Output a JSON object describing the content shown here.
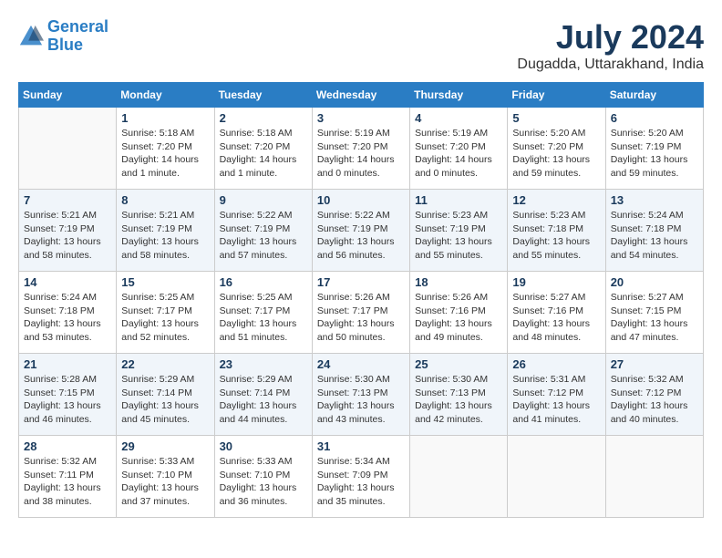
{
  "logo": {
    "line1": "General",
    "line2": "Blue"
  },
  "title": "July 2024",
  "location": "Dugadda, Uttarakhand, India",
  "days_of_week": [
    "Sunday",
    "Monday",
    "Tuesday",
    "Wednesday",
    "Thursday",
    "Friday",
    "Saturday"
  ],
  "weeks": [
    [
      {
        "num": "",
        "info": ""
      },
      {
        "num": "1",
        "info": "Sunrise: 5:18 AM\nSunset: 7:20 PM\nDaylight: 14 hours\nand 1 minute."
      },
      {
        "num": "2",
        "info": "Sunrise: 5:18 AM\nSunset: 7:20 PM\nDaylight: 14 hours\nand 1 minute."
      },
      {
        "num": "3",
        "info": "Sunrise: 5:19 AM\nSunset: 7:20 PM\nDaylight: 14 hours\nand 0 minutes."
      },
      {
        "num": "4",
        "info": "Sunrise: 5:19 AM\nSunset: 7:20 PM\nDaylight: 14 hours\nand 0 minutes."
      },
      {
        "num": "5",
        "info": "Sunrise: 5:20 AM\nSunset: 7:20 PM\nDaylight: 13 hours\nand 59 minutes."
      },
      {
        "num": "6",
        "info": "Sunrise: 5:20 AM\nSunset: 7:19 PM\nDaylight: 13 hours\nand 59 minutes."
      }
    ],
    [
      {
        "num": "7",
        "info": "Sunrise: 5:21 AM\nSunset: 7:19 PM\nDaylight: 13 hours\nand 58 minutes."
      },
      {
        "num": "8",
        "info": "Sunrise: 5:21 AM\nSunset: 7:19 PM\nDaylight: 13 hours\nand 58 minutes."
      },
      {
        "num": "9",
        "info": "Sunrise: 5:22 AM\nSunset: 7:19 PM\nDaylight: 13 hours\nand 57 minutes."
      },
      {
        "num": "10",
        "info": "Sunrise: 5:22 AM\nSunset: 7:19 PM\nDaylight: 13 hours\nand 56 minutes."
      },
      {
        "num": "11",
        "info": "Sunrise: 5:23 AM\nSunset: 7:19 PM\nDaylight: 13 hours\nand 55 minutes."
      },
      {
        "num": "12",
        "info": "Sunrise: 5:23 AM\nSunset: 7:18 PM\nDaylight: 13 hours\nand 55 minutes."
      },
      {
        "num": "13",
        "info": "Sunrise: 5:24 AM\nSunset: 7:18 PM\nDaylight: 13 hours\nand 54 minutes."
      }
    ],
    [
      {
        "num": "14",
        "info": "Sunrise: 5:24 AM\nSunset: 7:18 PM\nDaylight: 13 hours\nand 53 minutes."
      },
      {
        "num": "15",
        "info": "Sunrise: 5:25 AM\nSunset: 7:17 PM\nDaylight: 13 hours\nand 52 minutes."
      },
      {
        "num": "16",
        "info": "Sunrise: 5:25 AM\nSunset: 7:17 PM\nDaylight: 13 hours\nand 51 minutes."
      },
      {
        "num": "17",
        "info": "Sunrise: 5:26 AM\nSunset: 7:17 PM\nDaylight: 13 hours\nand 50 minutes."
      },
      {
        "num": "18",
        "info": "Sunrise: 5:26 AM\nSunset: 7:16 PM\nDaylight: 13 hours\nand 49 minutes."
      },
      {
        "num": "19",
        "info": "Sunrise: 5:27 AM\nSunset: 7:16 PM\nDaylight: 13 hours\nand 48 minutes."
      },
      {
        "num": "20",
        "info": "Sunrise: 5:27 AM\nSunset: 7:15 PM\nDaylight: 13 hours\nand 47 minutes."
      }
    ],
    [
      {
        "num": "21",
        "info": "Sunrise: 5:28 AM\nSunset: 7:15 PM\nDaylight: 13 hours\nand 46 minutes."
      },
      {
        "num": "22",
        "info": "Sunrise: 5:29 AM\nSunset: 7:14 PM\nDaylight: 13 hours\nand 45 minutes."
      },
      {
        "num": "23",
        "info": "Sunrise: 5:29 AM\nSunset: 7:14 PM\nDaylight: 13 hours\nand 44 minutes."
      },
      {
        "num": "24",
        "info": "Sunrise: 5:30 AM\nSunset: 7:13 PM\nDaylight: 13 hours\nand 43 minutes."
      },
      {
        "num": "25",
        "info": "Sunrise: 5:30 AM\nSunset: 7:13 PM\nDaylight: 13 hours\nand 42 minutes."
      },
      {
        "num": "26",
        "info": "Sunrise: 5:31 AM\nSunset: 7:12 PM\nDaylight: 13 hours\nand 41 minutes."
      },
      {
        "num": "27",
        "info": "Sunrise: 5:32 AM\nSunset: 7:12 PM\nDaylight: 13 hours\nand 40 minutes."
      }
    ],
    [
      {
        "num": "28",
        "info": "Sunrise: 5:32 AM\nSunset: 7:11 PM\nDaylight: 13 hours\nand 38 minutes."
      },
      {
        "num": "29",
        "info": "Sunrise: 5:33 AM\nSunset: 7:10 PM\nDaylight: 13 hours\nand 37 minutes."
      },
      {
        "num": "30",
        "info": "Sunrise: 5:33 AM\nSunset: 7:10 PM\nDaylight: 13 hours\nand 36 minutes."
      },
      {
        "num": "31",
        "info": "Sunrise: 5:34 AM\nSunset: 7:09 PM\nDaylight: 13 hours\nand 35 minutes."
      },
      {
        "num": "",
        "info": ""
      },
      {
        "num": "",
        "info": ""
      },
      {
        "num": "",
        "info": ""
      }
    ]
  ]
}
